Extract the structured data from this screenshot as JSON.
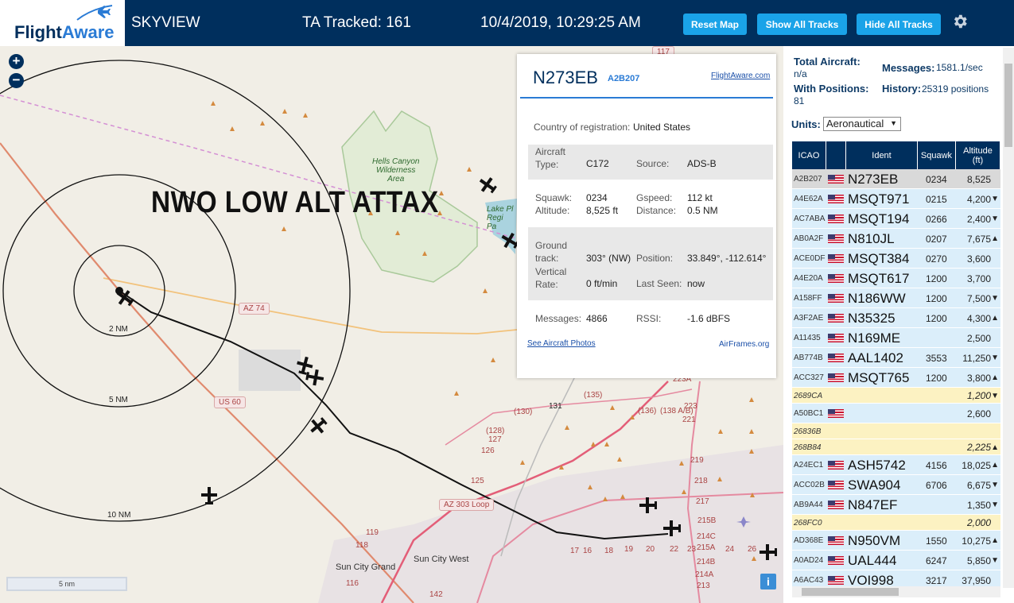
{
  "header": {
    "logo_text": "FlightAware",
    "site_name": "SKYVIEW",
    "tracked_label": "TA Tracked: 161",
    "datetime": "10/4/2019, 10:29:25 AM",
    "buttons": {
      "reset": "Reset Map",
      "show": "Show All Tracks",
      "hide": "Hide All Tracks"
    },
    "settings_icon": "gear-icon",
    "colors": {
      "bar": "#002f5d",
      "button": "#1aa3e8"
    }
  },
  "map": {
    "zoom_in": "+",
    "zoom_out": "−",
    "overlay_title": "NWO LOW ALT ATTAX",
    "range_labels": [
      "2 NM",
      "5 NM",
      "10 NM"
    ],
    "road_shields": [
      "AZ 74",
      "US 60",
      "AZ 303 Loop",
      "117"
    ],
    "places": [
      "Sun City Grand",
      "Sun City West"
    ],
    "park_label": "Hells Canyon\nWilderness\nArea",
    "lake_label": "Lake Pl\nRegi\nPa",
    "road_numbers": [
      "131",
      "(135)",
      "(130)",
      "(128)",
      "127",
      "126",
      "125",
      "119",
      "118",
      "116",
      "142",
      "(136)",
      "(138 A/B)",
      "223A",
      "223",
      "221",
      "219",
      "218",
      "217",
      "215B",
      "215A",
      "214C",
      "214B",
      "214A",
      "213",
      "17",
      "16",
      "18",
      "19",
      "20",
      "22",
      "23",
      "24",
      "26"
    ],
    "scale_label": "5 nm",
    "info_button": "i"
  },
  "popup": {
    "registration": "N273EB",
    "hex": "A2B207",
    "link": "FlightAware.com",
    "country_label": "Country of registration:",
    "country": "United States",
    "aircraft_type_label": "Aircraft\nType:",
    "aircraft_type": "C172",
    "source_label": "Source:",
    "source": "ADS-B",
    "squawk_label": "Squawk:",
    "squawk": "0234",
    "gspeed_label": "Gspeed:",
    "gspeed": "112 kt",
    "altitude_label": "Altitude:",
    "altitude": "8,525 ft",
    "distance_label": "Distance:",
    "distance": "0.5 NM",
    "ground_track_label": "Ground\ntrack:",
    "ground_track": "303° (NW)",
    "position_label": "Position:",
    "position": "33.849°, -112.614°",
    "vrate_label": "Vertical\nRate:",
    "vrate": "0 ft/min",
    "last_seen_label": "Last Seen:",
    "last_seen": "now",
    "messages_label": "Messages:",
    "messages": "4866",
    "rssi_label": "RSSI:",
    "rssi": "-1.6 dBFS",
    "photos_link": "See Aircraft Photos",
    "airframes_link": "AirFrames.org"
  },
  "sidebar": {
    "total_label": "Total Aircraft:",
    "total": "n/a",
    "messages_label": "Messages:",
    "messages": "1581.1/sec",
    "positions_label": "With Positions:",
    "positions": "81",
    "history_label": "History:",
    "history": "25319 positions",
    "units_label": "Units:",
    "units": "Aeronautical",
    "columns": [
      "ICAO",
      "",
      "Ident",
      "Squawk",
      "Altitude (ft)"
    ],
    "rows": [
      {
        "icao": "A2B207",
        "flag": true,
        "ident": "N273EB",
        "squawk": "0234",
        "alt": "8,525",
        "trend": "",
        "style": "selected"
      },
      {
        "icao": "A4E62A",
        "flag": true,
        "ident": "MSQT971",
        "squawk": "0215",
        "alt": "4,200",
        "trend": "▼",
        "style": "normal"
      },
      {
        "icao": "AC7ABA",
        "flag": true,
        "ident": "MSQT194",
        "squawk": "0266",
        "alt": "2,400",
        "trend": "▼",
        "style": "normal"
      },
      {
        "icao": "AB0A2F",
        "flag": true,
        "ident": "N810JL",
        "squawk": "0207",
        "alt": "7,675",
        "trend": "▲",
        "style": "normal"
      },
      {
        "icao": "ACE0DF",
        "flag": true,
        "ident": "MSQT384",
        "squawk": "0270",
        "alt": "3,600",
        "trend": "",
        "style": "normal"
      },
      {
        "icao": "A4E20A",
        "flag": true,
        "ident": "MSQT617",
        "squawk": "1200",
        "alt": "3,700",
        "trend": "",
        "style": "normal"
      },
      {
        "icao": "A158FF",
        "flag": true,
        "ident": "N186WW",
        "squawk": "1200",
        "alt": "7,500",
        "trend": "▼",
        "style": "normal"
      },
      {
        "icao": "A3F2AE",
        "flag": true,
        "ident": "N35325",
        "squawk": "1200",
        "alt": "4,300",
        "trend": "▲",
        "style": "normal"
      },
      {
        "icao": "A11435",
        "flag": true,
        "ident": "N169ME",
        "squawk": "",
        "alt": "2,500",
        "trend": "",
        "style": "normal"
      },
      {
        "icao": "AB774B",
        "flag": true,
        "ident": "AAL1402",
        "squawk": "3553",
        "alt": "11,250",
        "trend": "▼",
        "style": "normal"
      },
      {
        "icao": "ACC327",
        "flag": true,
        "ident": "MSQT765",
        "squawk": "1200",
        "alt": "3,800",
        "trend": "▲",
        "style": "normal"
      },
      {
        "icao": "2689CA",
        "flag": false,
        "ident": "",
        "squawk": "",
        "alt": "1,200",
        "trend": "▼",
        "style": "tisb"
      },
      {
        "icao": "A50BC1",
        "flag": true,
        "ident": "",
        "squawk": "",
        "alt": "2,600",
        "trend": "",
        "style": "normal"
      },
      {
        "icao": "26836B",
        "flag": false,
        "ident": "",
        "squawk": "",
        "alt": "",
        "trend": "",
        "style": "tisb"
      },
      {
        "icao": "268B84",
        "flag": false,
        "ident": "",
        "squawk": "",
        "alt": "2,225",
        "trend": "▲",
        "style": "tisb"
      },
      {
        "icao": "A24EC1",
        "flag": true,
        "ident": "ASH5742",
        "squawk": "4156",
        "alt": "18,025",
        "trend": "▲",
        "style": "normal"
      },
      {
        "icao": "ACC02B",
        "flag": true,
        "ident": "SWA904",
        "squawk": "6706",
        "alt": "6,675",
        "trend": "▼",
        "style": "normal"
      },
      {
        "icao": "AB9A44",
        "flag": true,
        "ident": "N847EF",
        "squawk": "",
        "alt": "1,350",
        "trend": "▼",
        "style": "normal"
      },
      {
        "icao": "268FC0",
        "flag": false,
        "ident": "",
        "squawk": "",
        "alt": "2,000",
        "trend": "",
        "style": "tisb"
      },
      {
        "icao": "AD368E",
        "flag": true,
        "ident": "N950VM",
        "squawk": "1550",
        "alt": "10,275",
        "trend": "▲",
        "style": "normal"
      },
      {
        "icao": "A0AD24",
        "flag": true,
        "ident": "UAL444",
        "squawk": "6247",
        "alt": "5,850",
        "trend": "▼",
        "style": "normal"
      },
      {
        "icao": "A6AC43",
        "flag": true,
        "ident": "VOI998",
        "squawk": "3217",
        "alt": "37,950",
        "trend": "",
        "style": "normal"
      }
    ],
    "row_colors": {
      "normal": "#dbeefa",
      "selected": "#d9d9d9",
      "tisb": "#fcf2c2"
    }
  }
}
